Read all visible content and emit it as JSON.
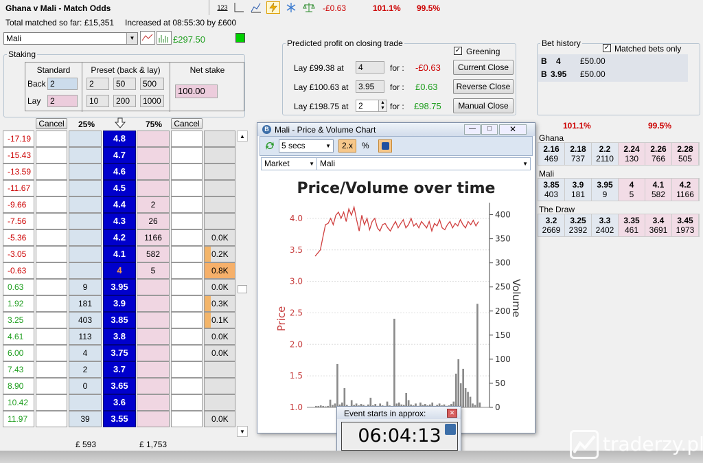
{
  "header": {
    "title": "Ghana v Mali - Match Odds",
    "total_matched": "Total matched so far: £15,351",
    "increased": "Increased at 08:55:30 by £600",
    "pl": "-£0.63",
    "book_back": "101.1%",
    "book_lay": "99.5%",
    "toolbar_text_icon": "123"
  },
  "selection": {
    "value": "Mali",
    "balance": "£297.50"
  },
  "staking": {
    "legend": "Staking",
    "standard_header": "Standard",
    "preset_header": "Preset (back & lay)",
    "net_header": "Net stake",
    "back_label": "Back",
    "lay_label": "Lay",
    "back_value": "2",
    "lay_value": "2",
    "preset_back": [
      "2",
      "50",
      "500"
    ],
    "preset_lay": [
      "10",
      "200",
      "1000"
    ],
    "net_value": "100.00"
  },
  "predicted": {
    "legend": "Predicted profit on closing trade",
    "greening_label": "Greening",
    "rows": [
      {
        "label": "Lay  £99.38  at",
        "odds": "4",
        "for": "for :",
        "profit": "-£0.63",
        "button": "Current Close"
      },
      {
        "label": "Lay  £100.63  at",
        "odds": "3.95",
        "for": "for :",
        "profit": "£0.63",
        "button": "Reverse Close"
      },
      {
        "label": "Lay  £198.75  at",
        "odds": "2",
        "for": "for :",
        "profit": "£98.75",
        "button": "Manual Close"
      }
    ]
  },
  "bet_history": {
    "legend": "Bet history",
    "matched_only": "Matched bets only",
    "rows": [
      {
        "type": "B",
        "odds": "4",
        "amount": "£50.00"
      },
      {
        "type": "B",
        "odds": "3.95",
        "amount": "£50.00"
      }
    ]
  },
  "ladder": {
    "cancel_back": "Cancel",
    "cancel_lay": "Cancel",
    "back_pct": "25%",
    "lay_pct": "75%",
    "arrow_icon": "down-arrow",
    "rows": [
      {
        "pl": "-17.19",
        "back": "",
        "price": "4.8",
        "lay": "",
        "vol": ""
      },
      {
        "pl": "-15.43",
        "back": "",
        "price": "4.7",
        "lay": "",
        "vol": ""
      },
      {
        "pl": "-13.59",
        "back": "",
        "price": "4.6",
        "lay": "",
        "vol": ""
      },
      {
        "pl": "-11.67",
        "back": "",
        "price": "4.5",
        "lay": "",
        "vol": ""
      },
      {
        "pl": "-9.66",
        "back": "",
        "price": "4.4",
        "lay": "2",
        "vol": ""
      },
      {
        "pl": "-7.56",
        "back": "",
        "price": "4.3",
        "lay": "26",
        "vol": ""
      },
      {
        "pl": "-5.36",
        "back": "",
        "price": "4.2",
        "lay": "1166",
        "vol": "0.0K"
      },
      {
        "pl": "-3.05",
        "back": "",
        "price": "4.1",
        "lay": "582",
        "vol": "0.2K"
      },
      {
        "pl": "-0.63",
        "back": "",
        "price": "4",
        "lay": "5",
        "vol": "0.8K"
      },
      {
        "pl": "0.63",
        "back": "9",
        "price": "3.95",
        "lay": "",
        "vol": "0.0K"
      },
      {
        "pl": "1.92",
        "back": "181",
        "price": "3.9",
        "lay": "",
        "vol": "0.3K"
      },
      {
        "pl": "3.25",
        "back": "403",
        "price": "3.85",
        "lay": "",
        "vol": "0.1K"
      },
      {
        "pl": "4.61",
        "back": "113",
        "price": "3.8",
        "lay": "",
        "vol": "0.0K"
      },
      {
        "pl": "6.00",
        "back": "4",
        "price": "3.75",
        "lay": "",
        "vol": "0.0K"
      },
      {
        "pl": "7.43",
        "back": "2",
        "price": "3.7",
        "lay": "",
        "vol": ""
      },
      {
        "pl": "8.90",
        "back": "0",
        "price": "3.65",
        "lay": "",
        "vol": ""
      },
      {
        "pl": "10.42",
        "back": "",
        "price": "3.6",
        "lay": "",
        "vol": ""
      },
      {
        "pl": "11.97",
        "back": "39",
        "price": "3.55",
        "lay": "",
        "vol": "0.0K"
      }
    ],
    "total_back": "£ 593",
    "total_lay": "£ 1,753"
  },
  "chart_window": {
    "title": "Mali - Price & Volume Chart",
    "interval": "5 secs",
    "zoom": "2.x",
    "pct": "%",
    "market_label": "Market",
    "runner": "Mali"
  },
  "chart_data": {
    "type": "line",
    "title": "Price/Volume over time",
    "ylabel": "Price",
    "y2label": "Volume",
    "ylim": [
      1.0,
      4.25
    ],
    "y2lim": [
      0,
      425
    ],
    "yticks": [
      "1.0",
      "1.5",
      "2.0",
      "2.5",
      "3.0",
      "3.5",
      "4.0"
    ],
    "y2ticks": [
      "0",
      "50",
      "100",
      "150",
      "200",
      "250",
      "300",
      "350",
      "400"
    ],
    "series": [
      {
        "values": [
          3.4,
          3.45,
          3.5,
          3.7,
          3.9,
          3.92,
          4.0,
          3.9,
          4.05,
          4.1,
          4.0,
          4.1,
          3.95,
          4.15,
          4.05,
          4.18,
          3.98,
          3.8,
          4.05,
          3.9,
          4.0,
          3.82,
          3.95,
          4.0,
          3.85,
          3.8,
          3.9,
          3.92,
          3.85,
          3.8,
          3.88,
          3.95,
          3.85,
          3.92,
          3.98,
          3.85,
          3.9,
          4.0,
          3.88,
          3.92,
          3.85,
          3.95,
          3.9,
          3.85,
          3.95,
          3.8,
          3.92,
          3.88,
          3.98,
          3.85,
          3.82,
          3.9,
          3.95,
          3.85,
          3.92,
          3.88,
          3.98,
          3.9,
          3.85,
          3.95,
          3.9,
          3.97,
          3.88,
          3.95
        ]
      },
      {
        "values": [
          3,
          3,
          4,
          3,
          2,
          3,
          16,
          5,
          8,
          90,
          6,
          10,
          40,
          5,
          2,
          15,
          5,
          8,
          4,
          7,
          5,
          3,
          6,
          20,
          4,
          7,
          3,
          8,
          4,
          3,
          12,
          4,
          2,
          184,
          8,
          10,
          6,
          5,
          30,
          15,
          6,
          4,
          8,
          3,
          10,
          5,
          7,
          4,
          6,
          10,
          3,
          5,
          8,
          4,
          6,
          3,
          4,
          7,
          12,
          70,
          100,
          50,
          80,
          40,
          32,
          22,
          8,
          5,
          215,
          10
        ]
      }
    ]
  },
  "countdown": {
    "label": "Event starts in approx:",
    "time": "06:04:13"
  },
  "market_view": {
    "book_back": "101.1%",
    "book_lay": "99.5%",
    "runners": [
      {
        "name": "Ghana",
        "prices": [
          [
            "2.16",
            "469"
          ],
          [
            "2.18",
            "737"
          ],
          [
            "2.2",
            "2110"
          ],
          [
            "2.24",
            "130"
          ],
          [
            "2.26",
            "766"
          ],
          [
            "2.28",
            "505"
          ]
        ]
      },
      {
        "name": "Mali",
        "prices": [
          [
            "3.85",
            "403"
          ],
          [
            "3.9",
            "181"
          ],
          [
            "3.95",
            "9"
          ],
          [
            "4",
            "5"
          ],
          [
            "4.1",
            "582"
          ],
          [
            "4.2",
            "1166"
          ]
        ]
      },
      {
        "name": "The Draw",
        "prices": [
          [
            "3.2",
            "2669"
          ],
          [
            "3.25",
            "2392"
          ],
          [
            "3.3",
            "2402"
          ],
          [
            "3.35",
            "461"
          ],
          [
            "3.4",
            "3691"
          ],
          [
            "3.45",
            "1973"
          ]
        ]
      }
    ]
  },
  "watermark": {
    "text": "traderzy.pl"
  }
}
